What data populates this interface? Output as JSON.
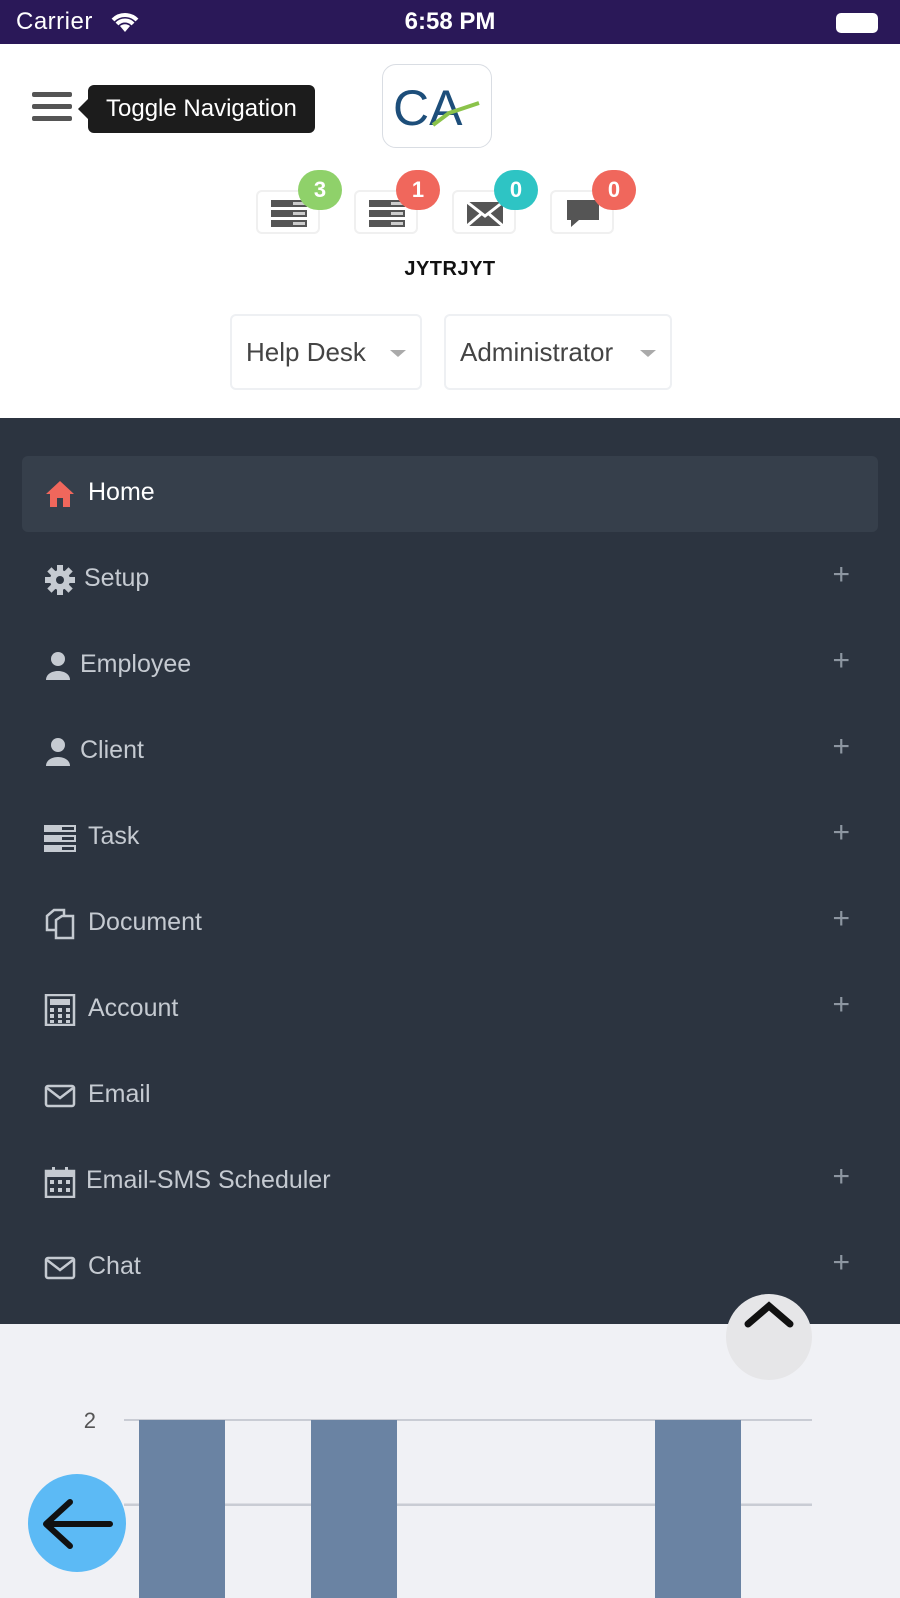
{
  "status_bar": {
    "carrier": "Carrier",
    "time": "6:58 PM"
  },
  "header": {
    "tooltip": "Toggle Navigation",
    "logo_text": "CA",
    "username": "JYTRJYT",
    "notifications": [
      {
        "icon": "task-list-icon",
        "count": "3",
        "color": "#8fd16a"
      },
      {
        "icon": "task-list-icon",
        "count": "1",
        "color": "#f0675c"
      },
      {
        "icon": "envelope-icon",
        "count": "0",
        "color": "#2ec4c4"
      },
      {
        "icon": "chat-icon",
        "count": "0",
        "color": "#f0675c"
      }
    ],
    "department": "Help Desk",
    "role": "Administrator"
  },
  "sidebar": {
    "items": [
      {
        "label": "Home",
        "icon": "home-icon",
        "active": true,
        "expandable": false
      },
      {
        "label": "Setup",
        "icon": "gear-icon",
        "expandable": true
      },
      {
        "label": "Employee",
        "icon": "user-icon",
        "expandable": true
      },
      {
        "label": "Client",
        "icon": "user-icon",
        "expandable": true
      },
      {
        "label": "Task",
        "icon": "task-list-icon",
        "expandable": true
      },
      {
        "label": "Document",
        "icon": "documents-icon",
        "expandable": true
      },
      {
        "label": "Account",
        "icon": "calculator-icon",
        "expandable": true
      },
      {
        "label": "Email",
        "icon": "envelope-icon",
        "expandable": false
      },
      {
        "label": "Email-SMS Scheduler",
        "icon": "calendar-icon",
        "expandable": true
      },
      {
        "label": "Chat",
        "icon": "envelope-icon",
        "expandable": true
      }
    ],
    "expand_glyph": "+"
  },
  "chart_data": {
    "type": "bar",
    "categories": [
      "",
      "",
      "",
      ""
    ],
    "values": [
      2,
      2,
      0,
      2
    ],
    "ytick_labels": [
      "2",
      "1"
    ],
    "ylim_visible": [
      1,
      2
    ],
    "bar_color": "#6a83a3"
  }
}
